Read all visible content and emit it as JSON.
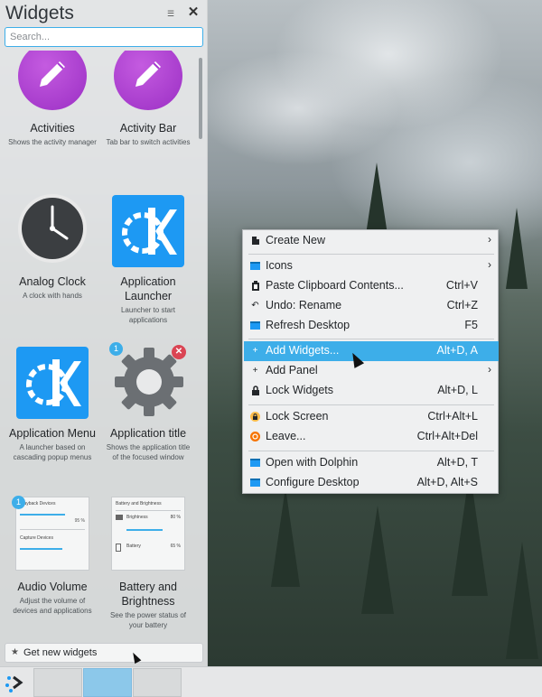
{
  "widgets_panel": {
    "title": "Widgets",
    "search_placeholder": "Search...",
    "menu_icon": "hamburger-icon",
    "close_icon": "close-icon",
    "widgets": [
      {
        "name": "Activities",
        "description": "Shows the activity manager",
        "icon": "pencil-icon"
      },
      {
        "name": "Activity Bar",
        "description": "Tab bar to switch activities",
        "icon": "pencil-icon"
      },
      {
        "name": "Analog Clock",
        "description": "A clock with hands",
        "icon": "clock-icon"
      },
      {
        "name": "Application Launcher",
        "description": "Launcher to start applications",
        "icon": "kde-logo-icon"
      },
      {
        "name": "Application Menu",
        "description": "A launcher based on cascading popup menus",
        "icon": "kde-logo-icon",
        "badge": "1"
      },
      {
        "name": "Application title",
        "description": "Shows the application title of the focused window",
        "icon": "gear-icon",
        "badge": "1"
      },
      {
        "name": "Audio Volume",
        "description": "Adjust the volume of devices and applications",
        "icon": "audio-volume-preview",
        "badge": "1",
        "preview": {
          "heading1": "Playback Devices",
          "heading2": "Capture Devices",
          "percent": "95 %"
        }
      },
      {
        "name": "Battery and Brightness",
        "description": "See the power status of your battery",
        "icon": "battery-preview",
        "preview": {
          "heading": "Battery and Brightness",
          "row1": "Brightness",
          "row1_value": "80 %",
          "row2": "Battery",
          "row2_value": "65 %"
        }
      }
    ],
    "get_new_label": "Get new widgets"
  },
  "context_menu": {
    "items": [
      {
        "label": "Create New",
        "shortcut": "",
        "submenu": true,
        "icon": "new-document-icon"
      },
      {
        "label": "Icons",
        "shortcut": "",
        "submenu": true,
        "icon": "icons-view-icon"
      },
      {
        "label": "Paste Clipboard Contents...",
        "shortcut": "Ctrl+V",
        "icon": "paste-icon"
      },
      {
        "label": "Undo: Rename",
        "shortcut": "Ctrl+Z",
        "icon": "undo-icon"
      },
      {
        "label": "Refresh Desktop",
        "shortcut": "F5",
        "icon": "refresh-icon"
      },
      {
        "label": "Add Widgets...",
        "shortcut": "Alt+D, A",
        "icon": "plus-icon",
        "highlighted": true
      },
      {
        "label": "Add Panel",
        "shortcut": "",
        "submenu": true,
        "icon": "plus-icon"
      },
      {
        "label": "Lock Widgets",
        "shortcut": "Alt+D, L",
        "icon": "lock-icon"
      },
      {
        "label": "Lock Screen",
        "shortcut": "Ctrl+Alt+L",
        "icon": "lock-screen-icon"
      },
      {
        "label": "Leave...",
        "shortcut": "Ctrl+Alt+Del",
        "icon": "leave-icon"
      },
      {
        "label": "Open with Dolphin",
        "shortcut": "Alt+D, T",
        "icon": "folder-icon"
      },
      {
        "label": "Configure Desktop",
        "shortcut": "Alt+D, Alt+S",
        "icon": "configure-icon"
      }
    ]
  },
  "taskbar": {
    "launcher_icon": "plasma-launcher-icon",
    "pager": {
      "desktops": 3,
      "active": 2
    }
  },
  "colors": {
    "accent": "#3daee9",
    "kde_blue": "#1d99f3",
    "purple": "#a83ad1",
    "close_badge": "#da4453"
  }
}
